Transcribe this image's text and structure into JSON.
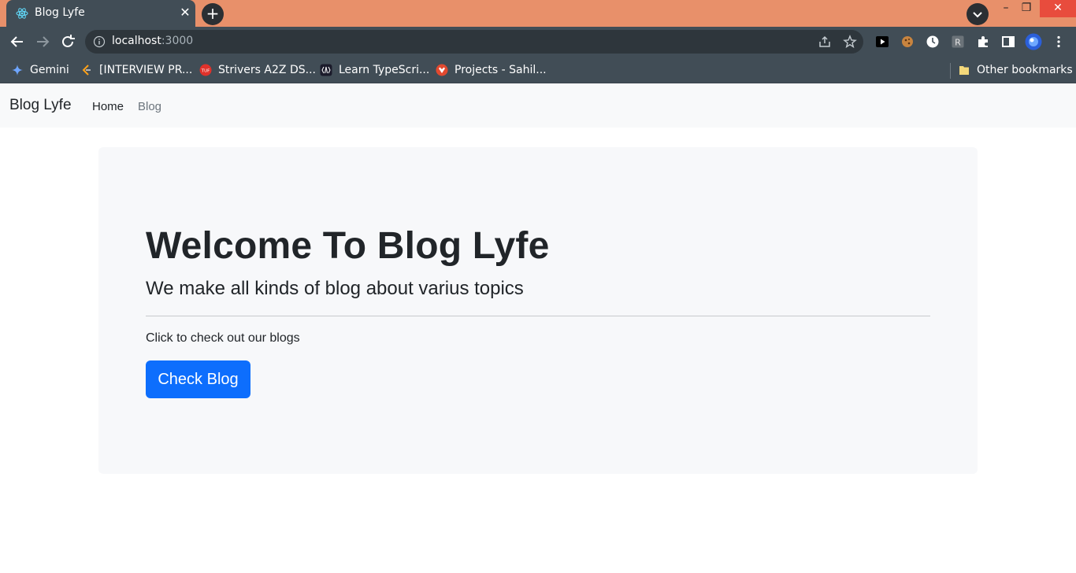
{
  "browser": {
    "tab_title": "Blog Lyfe",
    "tab_close": "✕",
    "new_tab": "+",
    "url_host": "localhost",
    "url_port": ":3000",
    "window_minimize": "–",
    "window_restore": "❐",
    "window_close": "✕",
    "bookmarks": [
      {
        "label": "Gemini",
        "icon": "gemini-icon"
      },
      {
        "label": "[INTERVIEW PR...",
        "icon": "leetcode-icon"
      },
      {
        "label": "Strivers A2Z DS...",
        "icon": "tuf-icon"
      },
      {
        "label": "Learn TypeScri...",
        "icon": "typescript-icon"
      },
      {
        "label": "Projects - Sahil...",
        "icon": "gitlab-icon"
      }
    ],
    "other_bookmarks": "Other bookmarks",
    "colors": {
      "tabbar": "#e8906a",
      "toolbar": "#414d56"
    }
  },
  "navbar": {
    "brand": "Blog Lyfe",
    "links": [
      "Home",
      "Blog"
    ]
  },
  "hero": {
    "title": "Welcome To Blog Lyfe",
    "subtitle": "We make all kinds of blog about varius topics",
    "text": "Click to check out our blogs",
    "button": "Check Blog",
    "colors": {
      "button": "#0d6efd"
    }
  }
}
